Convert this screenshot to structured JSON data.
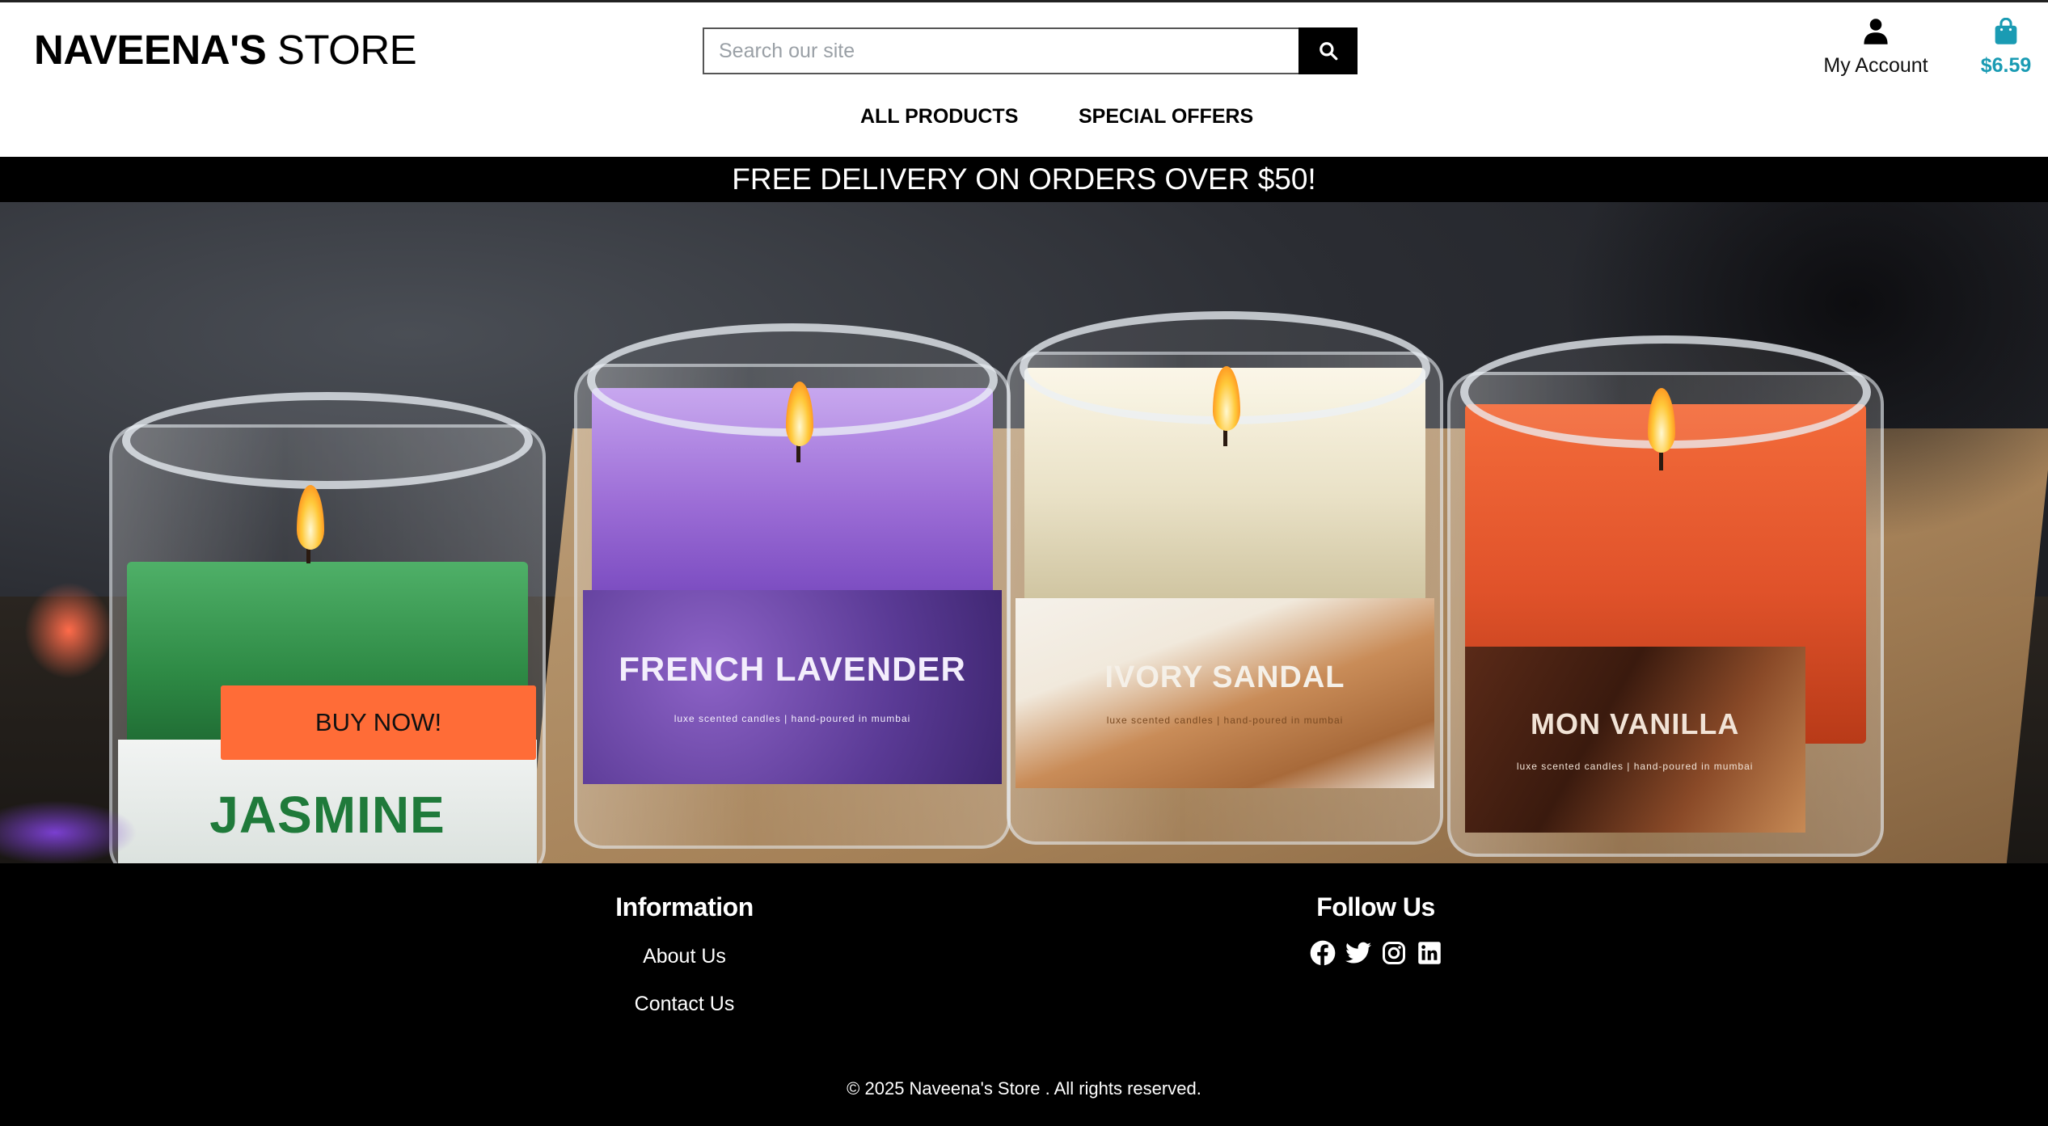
{
  "header": {
    "logo_bold": "NAVEENA'S",
    "logo_light": "STORE",
    "search": {
      "placeholder": "Search our site",
      "value": ""
    },
    "account_label": "My Account",
    "bag_total": "$6.59"
  },
  "nav": {
    "items": [
      {
        "label": "ALL PRODUCTS"
      },
      {
        "label": "SPECIAL OFFERS"
      }
    ]
  },
  "promo_banner": "FREE DELIVERY ON ORDERS OVER $50!",
  "hero": {
    "cta_label": "BUY NOW!",
    "products": [
      {
        "label": "JASMINE",
        "wax_color": "#2e8a45"
      },
      {
        "label": "FRENCH LAVENDER",
        "wax_color": "#9c6dd6"
      },
      {
        "label": "IVORY SANDAL",
        "wax_color": "#e9e1c6"
      },
      {
        "label": "MON VANILLA",
        "wax_color": "#e0522a"
      }
    ],
    "label_subtext": "luxe scented candles | hand-poured in mumbai"
  },
  "footer": {
    "information_title": "Information",
    "information_links": [
      "About Us",
      "Contact Us"
    ],
    "follow_title": "Follow Us",
    "socials": [
      "facebook-icon",
      "twitter-icon",
      "instagram-icon",
      "linkedin-icon"
    ],
    "copyright": "© 2025 Naveena's Store . All rights reserved."
  },
  "colors": {
    "accent_cta": "#ff6c37",
    "bag_total": "#1a9bb3",
    "promo_bg": "#000000",
    "footer_bg": "#000000"
  }
}
